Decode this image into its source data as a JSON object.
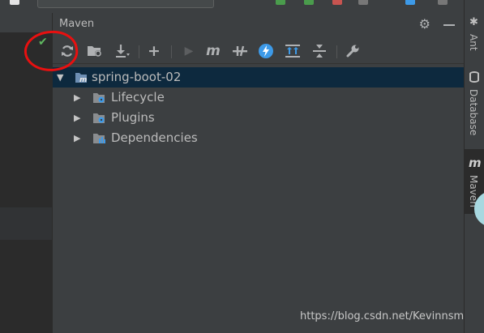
{
  "maven_panel": {
    "title": "Maven",
    "toolbar": [
      {
        "name": "reload-all-projects-button",
        "glyph": "⟳"
      },
      {
        "name": "generate-sources-button",
        "glyph": "▣"
      },
      {
        "name": "download-sources-button",
        "glyph": "⤓"
      },
      {
        "name": "add-maven-project-button",
        "glyph": "+"
      },
      {
        "name": "run-maven-build-button",
        "glyph": "▶"
      },
      {
        "name": "execute-maven-goal-button",
        "glyph": "m"
      },
      {
        "name": "toggle-offline-mode-button",
        "glyph": "⊣"
      },
      {
        "name": "skip-tests-button",
        "glyph": "ϟ"
      },
      {
        "name": "show-dependencies-button",
        "glyph": "⇈"
      },
      {
        "name": "collapse-all-button",
        "glyph": "⇕"
      },
      {
        "name": "maven-settings-button",
        "glyph": "🔧"
      }
    ],
    "tree": {
      "project": "spring-boot-02",
      "children": [
        {
          "label": "Lifecycle",
          "icon": "folder-gear-icon"
        },
        {
          "label": "Plugins",
          "icon": "folder-gear-icon"
        },
        {
          "label": "Dependencies",
          "icon": "folder-bars-icon"
        }
      ]
    }
  },
  "right_stripe": {
    "ant": "Ant",
    "database": "Database",
    "maven": "Maven"
  },
  "watermark": "https://blog.csdn.net/Kevinnsm",
  "colors": {
    "panel_bg": "#3c3f41",
    "editor_bg": "#2b2b2b",
    "selection": "#0d293e",
    "annotation": "#e81010",
    "accent_blue": "#3d9ae8"
  }
}
